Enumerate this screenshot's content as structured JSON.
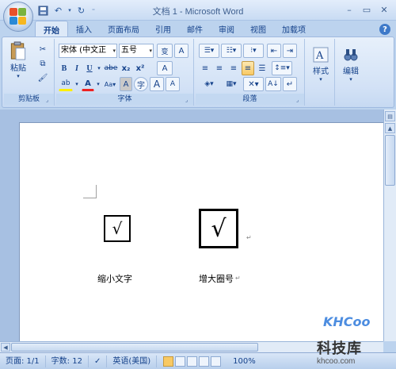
{
  "window": {
    "title": "文档 1 - Microsoft Word",
    "min": "–",
    "max": "▭",
    "close": "✕"
  },
  "quick_access": {
    "save_icon": "save-icon",
    "undo_icon": "undo-icon",
    "redo_icon": "redo-icon",
    "customize_icon": "customize-icon"
  },
  "tabs": [
    {
      "label": "开始",
      "active": true
    },
    {
      "label": "插入"
    },
    {
      "label": "页面布局"
    },
    {
      "label": "引用"
    },
    {
      "label": "邮件"
    },
    {
      "label": "审阅"
    },
    {
      "label": "视图"
    },
    {
      "label": "加载项"
    }
  ],
  "ribbon": {
    "clipboard": {
      "label": "剪贴板",
      "paste_label": "粘贴"
    },
    "font": {
      "label": "字体",
      "font_name": "宋体 (中文正文)",
      "font_size": "五号",
      "bold": "B",
      "italic": "I",
      "underline": "U",
      "strike": "abe",
      "subscript": "x₂",
      "superscript": "x²",
      "clear": "A",
      "highlight": "ab",
      "font_color": "A",
      "char_shading": "A",
      "enclose": "字",
      "grow": "A",
      "shrink": "A",
      "phonetic": "变",
      "char_border": "A"
    },
    "paragraph": {
      "label": "段落"
    },
    "styles": {
      "label": "样式"
    },
    "editing": {
      "label": "编辑"
    }
  },
  "document": {
    "symbol": "√",
    "caption_small": "缩小文字",
    "caption_large": "增大圈号",
    "para_mark": "↵"
  },
  "status": {
    "page": "页面: 1/1",
    "words": "字数: 12",
    "language": "英语(美国)",
    "zoom": "100%"
  },
  "watermark": {
    "logo": "KHCoo",
    "name": "科技库",
    "url": "khcoo.com"
  },
  "colors": {
    "accent": "#15428b",
    "ribbon_bg": "#dbe8f8",
    "highlight": "#f8c964"
  }
}
